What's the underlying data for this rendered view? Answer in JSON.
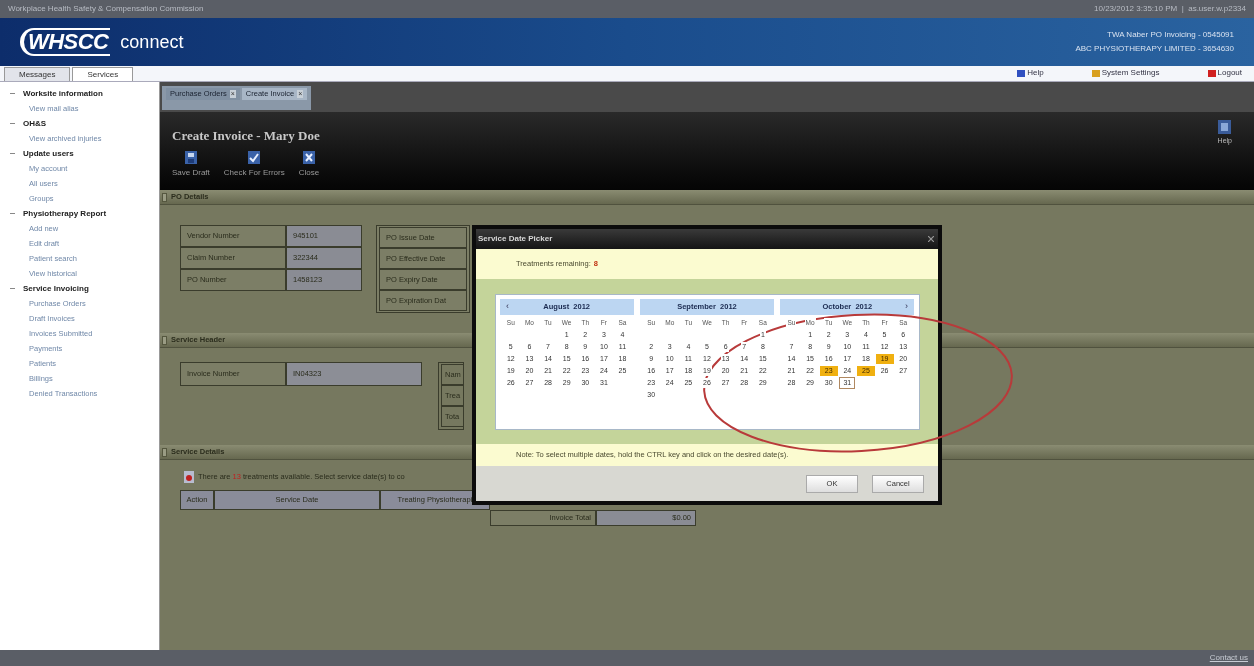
{
  "top_bar": {
    "title": "Workplace Health Safety & Compensation Commission",
    "session": "10/23/2012 3:35:10 PM  |  as.user.w.p2334"
  },
  "header": {
    "logo": "WHSCC",
    "product": "connect",
    "account_lines": [
      "TWA Naber PO Invoicing - 0545091",
      "ABC PHYSIOTHERAPY LIMITED - 3654630"
    ]
  },
  "nav_tabs": [
    {
      "label": "Messages",
      "selected": false
    },
    {
      "label": "Services",
      "selected": true
    }
  ],
  "header_links": [
    {
      "label": "Help",
      "color": "#3050c0"
    },
    {
      "label": "System Settings",
      "color": "#d8a020"
    },
    {
      "label": "Logout",
      "color": "#d02020"
    }
  ],
  "sidebar": {
    "groups": [
      {
        "title": "Worksite information",
        "children": [
          {
            "label": "View mail alias"
          }
        ]
      },
      {
        "title": "OH&S",
        "children": [
          {
            "label": "View archived injuries"
          }
        ]
      },
      {
        "title": "Update users",
        "children": [
          {
            "label": "My account"
          },
          {
            "label": "All users"
          },
          {
            "label": "Groups"
          }
        ]
      },
      {
        "title": "Physiotherapy Report",
        "children": [
          {
            "label": "Add new"
          },
          {
            "label": "Edit draft"
          },
          {
            "label": "Patient search"
          },
          {
            "label": "View historical"
          }
        ]
      },
      {
        "title": "Service Invoicing",
        "children": [
          {
            "label": "Purchase Orders"
          },
          {
            "label": "Draft Invoices"
          },
          {
            "label": "Invoices Submitted"
          },
          {
            "label": "Payments"
          },
          {
            "label": "Patients"
          },
          {
            "label": "Billings"
          },
          {
            "label": "Denied Transactions"
          }
        ]
      }
    ]
  },
  "doc_tabs": [
    {
      "label": "Purchase Orders",
      "close": "×",
      "selected": false
    },
    {
      "label": "Create Invoice",
      "close": "×",
      "selected": true
    }
  ],
  "page": {
    "title": "Create Invoice - Mary Doe",
    "help": "Help",
    "toolbar": [
      {
        "kind": "save",
        "label": "Save Draft"
      },
      {
        "kind": "check",
        "label": "Check For Errors"
      },
      {
        "kind": "close",
        "label": "Close"
      }
    ]
  },
  "po_details": {
    "title": "PO Details",
    "left_rows": [
      {
        "label": "Vendor Number",
        "value": "945101"
      },
      {
        "label": "Claim Number",
        "value": "322344"
      },
      {
        "label": "PO Number",
        "value": "1458123"
      }
    ],
    "right_labels": [
      "PO Issue Date",
      "PO Effective Date",
      "PO Expiry Date",
      "PO Expiration Dat"
    ]
  },
  "service_header": {
    "title": "Service Header",
    "invoice_label": "Invoice Number",
    "invoice_value": "IN04323",
    "right_labels": [
      "Nam",
      "Trea",
      "Tota"
    ]
  },
  "service_details": {
    "title": "Service Details",
    "message_before": "There are",
    "count": "13",
    "message_after": "treatments available. Select service date(s) to co",
    "columns": [
      "Action",
      "Service Date",
      "Treating Physiotherapi"
    ],
    "total_label": "Invoice Total",
    "total_value": "$0.00"
  },
  "dialog": {
    "title": "Service Date Picker",
    "remaining_label": "Treatments remaining:",
    "remaining": "8",
    "note": "Note: To select multiple dates, hold the CTRL key and click on the desired date(s).",
    "prev": "‹",
    "next": "›",
    "buttons": [
      "OK",
      "Cancel"
    ],
    "months": [
      {
        "title": "August  2012",
        "weekdays": [
          "Su",
          "Mo",
          "Tu",
          "We",
          "Th",
          "Fr",
          "Sa"
        ],
        "weeks": [
          [
            {
              "d": "1",
              "selected": false,
              "today": false
            },
            {
              "d": "2",
              "selected": false,
              "today": false
            },
            {
              "d": "3",
              "selected": false,
              "today": false
            },
            {
              "d": "4",
              "selected": false,
              "today": false
            }
          ],
          [
            {
              "d": "5",
              "selected": false,
              "today": false
            },
            {
              "d": "6",
              "selected": false,
              "today": false
            },
            {
              "d": "7",
              "selected": false,
              "today": false
            },
            {
              "d": "8",
              "selected": false,
              "today": false
            },
            {
              "d": "9",
              "selected": false,
              "today": false
            },
            {
              "d": "10",
              "selected": false,
              "today": false
            },
            {
              "d": "11",
              "selected": false,
              "today": false
            }
          ],
          [
            {
              "d": "12",
              "selected": false,
              "today": false
            },
            {
              "d": "13",
              "selected": false,
              "today": false
            },
            {
              "d": "14",
              "selected": false,
              "today": false
            },
            {
              "d": "15",
              "selected": false,
              "today": false
            },
            {
              "d": "16",
              "selected": false,
              "today": false
            },
            {
              "d": "17",
              "selected": false,
              "today": false
            },
            {
              "d": "18",
              "selected": false,
              "today": false
            }
          ],
          [
            {
              "d": "19",
              "selected": false,
              "today": false
            },
            {
              "d": "20",
              "selected": false,
              "today": false
            },
            {
              "d": "21",
              "selected": false,
              "today": false
            },
            {
              "d": "22",
              "selected": false,
              "today": false
            },
            {
              "d": "23",
              "selected": false,
              "today": false
            },
            {
              "d": "24",
              "selected": false,
              "today": false
            },
            {
              "d": "25",
              "selected": false,
              "today": false
            }
          ],
          [
            {
              "d": "26",
              "selected": false,
              "today": false
            },
            {
              "d": "27",
              "selected": false,
              "today": false
            },
            {
              "d": "28",
              "selected": false,
              "today": false
            },
            {
              "d": "29",
              "selected": false,
              "today": false
            },
            {
              "d": "30",
              "selected": false,
              "today": false
            },
            {
              "d": "31",
              "selected": false,
              "today": false
            }
          ]
        ]
      },
      {
        "title": "September  2012",
        "weekdays": [
          "Su",
          "Mo",
          "Tu",
          "We",
          "Th",
          "Fr",
          "Sa"
        ],
        "weeks": [
          [
            {
              "d": "1",
              "selected": false,
              "today": false
            }
          ],
          [
            {
              "d": "2",
              "selected": false,
              "today": false
            },
            {
              "d": "3",
              "selected": false,
              "today": false
            },
            {
              "d": "4",
              "selected": false,
              "today": false
            },
            {
              "d": "5",
              "selected": false,
              "today": false
            },
            {
              "d": "6",
              "selected": false,
              "today": false
            },
            {
              "d": "7",
              "selected": false,
              "today": false
            },
            {
              "d": "8",
              "selected": false,
              "today": false
            }
          ],
          [
            {
              "d": "9",
              "selected": false,
              "today": false
            },
            {
              "d": "10",
              "selected": false,
              "today": false
            },
            {
              "d": "11",
              "selected": false,
              "today": false
            },
            {
              "d": "12",
              "selected": false,
              "today": false
            },
            {
              "d": "13",
              "selected": false,
              "today": false
            },
            {
              "d": "14",
              "selected": false,
              "today": false
            },
            {
              "d": "15",
              "selected": false,
              "today": false
            }
          ],
          [
            {
              "d": "16",
              "selected": false,
              "today": false
            },
            {
              "d": "17",
              "selected": false,
              "today": false
            },
            {
              "d": "18",
              "selected": false,
              "today": false
            },
            {
              "d": "19",
              "selected": false,
              "today": false
            },
            {
              "d": "20",
              "selected": false,
              "today": false
            },
            {
              "d": "21",
              "selected": false,
              "today": false
            },
            {
              "d": "22",
              "selected": false,
              "today": false
            }
          ],
          [
            {
              "d": "23",
              "selected": false,
              "today": false
            },
            {
              "d": "24",
              "selected": false,
              "today": false
            },
            {
              "d": "25",
              "selected": false,
              "today": false
            },
            {
              "d": "26",
              "selected": false,
              "today": false
            },
            {
              "d": "27",
              "selected": false,
              "today": false
            },
            {
              "d": "28",
              "selected": false,
              "today": false
            },
            {
              "d": "29",
              "selected": false,
              "today": false
            }
          ],
          [
            {
              "d": "30",
              "selected": false,
              "today": false
            }
          ]
        ]
      },
      {
        "title": "October  2012",
        "weekdays": [
          "Su",
          "Mo",
          "Tu",
          "We",
          "Th",
          "Fr",
          "Sa"
        ],
        "weeks": [
          [
            {
              "d": "1",
              "selected": false,
              "today": false
            },
            {
              "d": "2",
              "selected": false,
              "today": false
            },
            {
              "d": "3",
              "selected": false,
              "today": false
            },
            {
              "d": "4",
              "selected": false,
              "today": false
            },
            {
              "d": "5",
              "selected": false,
              "today": false
            },
            {
              "d": "6",
              "selected": false,
              "today": false
            }
          ],
          [
            {
              "d": "7",
              "selected": false,
              "today": false
            },
            {
              "d": "8",
              "selected": false,
              "today": false
            },
            {
              "d": "9",
              "selected": false,
              "today": false
            },
            {
              "d": "10",
              "selected": false,
              "today": false
            },
            {
              "d": "11",
              "selected": false,
              "today": false
            },
            {
              "d": "12",
              "selected": false,
              "today": false
            },
            {
              "d": "13",
              "selected": false,
              "today": false
            }
          ],
          [
            {
              "d": "14",
              "selected": false,
              "today": false
            },
            {
              "d": "15",
              "selected": false,
              "today": false
            },
            {
              "d": "16",
              "selected": false,
              "today": false
            },
            {
              "d": "17",
              "selected": false,
              "today": false
            },
            {
              "d": "18",
              "selected": false,
              "today": false
            },
            {
              "d": "19",
              "selected": true,
              "today": false
            },
            {
              "d": "20",
              "selected": false,
              "today": false
            }
          ],
          [
            {
              "d": "21",
              "selected": false,
              "today": false
            },
            {
              "d": "22",
              "selected": false,
              "today": false
            },
            {
              "d": "23",
              "selected": true,
              "today": false
            },
            {
              "d": "24",
              "selected": false,
              "today": false
            },
            {
              "d": "25",
              "selected": true,
              "today": false
            },
            {
              "d": "26",
              "selected": false,
              "today": false
            },
            {
              "d": "27",
              "selected": false,
              "today": false
            }
          ],
          [
            {
              "d": "28",
              "selected": false,
              "today": false
            },
            {
              "d": "29",
              "selected": false,
              "today": false
            },
            {
              "d": "30",
              "selected": false,
              "today": false
            },
            {
              "d": "31",
              "selected": false,
              "today": true
            }
          ]
        ]
      }
    ]
  },
  "footer": {
    "link": "Contact us"
  }
}
